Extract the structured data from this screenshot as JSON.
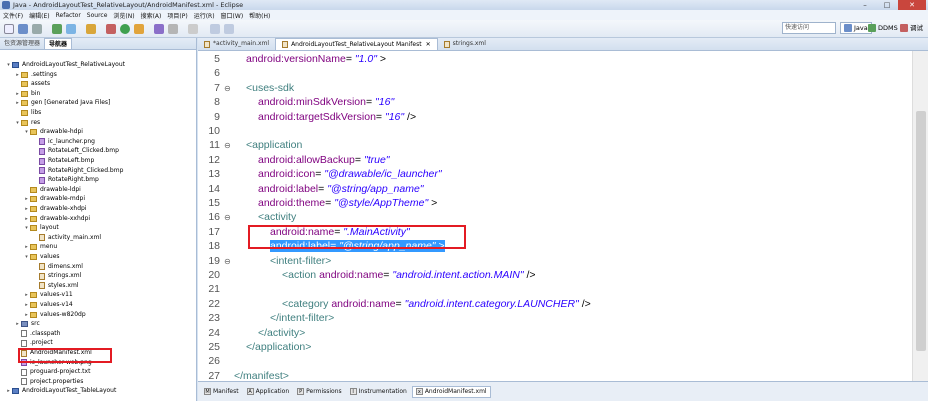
{
  "window": {
    "title": "Java - AndroidLayoutTest_RelativeLayout/AndroidManifest.xml - Eclipse",
    "minimize": "–",
    "maximize": "□",
    "close": "✕"
  },
  "menu": [
    "文件(F)",
    "编辑(E)",
    "Refactor",
    "Source",
    "浏览(N)",
    "搜索(A)",
    "项目(P)",
    "运行(R)",
    "窗口(W)",
    "帮助(H)"
  ],
  "toolbar": {
    "quick_access": "快速访问",
    "perspectives": [
      "Java",
      "DDMS",
      "调试"
    ]
  },
  "left_panel": {
    "tabs": [
      "包资源管理器",
      "导航器"
    ],
    "tree": [
      {
        "label": "AndroidLayoutTest_RelativeLayout",
        "depth": 0,
        "icon": "project-icon",
        "tw": "▾"
      },
      {
        "label": ".settings",
        "depth": 1,
        "icon": "folder-icon",
        "tw": "▸"
      },
      {
        "label": "assets",
        "depth": 1,
        "icon": "folder-icon",
        "tw": ""
      },
      {
        "label": "bin",
        "depth": 1,
        "icon": "folder-icon",
        "tw": "▸"
      },
      {
        "label": "gen [Generated Java Files]",
        "depth": 1,
        "icon": "folder-icon",
        "tw": "▸"
      },
      {
        "label": "libs",
        "depth": 1,
        "icon": "folder-icon",
        "tw": ""
      },
      {
        "label": "res",
        "depth": 1,
        "icon": "folder-icon",
        "tw": "▾"
      },
      {
        "label": "drawable-hdpi",
        "depth": 2,
        "icon": "folder-icon",
        "tw": "▾"
      },
      {
        "label": "ic_launcher.png",
        "depth": 3,
        "icon": "image-file-icon",
        "tw": ""
      },
      {
        "label": "RotateLeft_Clicked.bmp",
        "depth": 3,
        "icon": "image-file-icon",
        "tw": ""
      },
      {
        "label": "RotateLeft.bmp",
        "depth": 3,
        "icon": "image-file-icon",
        "tw": ""
      },
      {
        "label": "RotateRight_Clicked.bmp",
        "depth": 3,
        "icon": "image-file-icon",
        "tw": ""
      },
      {
        "label": "RotateRight.bmp",
        "depth": 3,
        "icon": "image-file-icon",
        "tw": ""
      },
      {
        "label": "drawable-ldpi",
        "depth": 2,
        "icon": "folder-icon",
        "tw": ""
      },
      {
        "label": "drawable-mdpi",
        "depth": 2,
        "icon": "folder-icon",
        "tw": "▸"
      },
      {
        "label": "drawable-xhdpi",
        "depth": 2,
        "icon": "folder-icon",
        "tw": "▸"
      },
      {
        "label": "drawable-xxhdpi",
        "depth": 2,
        "icon": "folder-icon",
        "tw": "▸"
      },
      {
        "label": "layout",
        "depth": 2,
        "icon": "folder-icon",
        "tw": "▾"
      },
      {
        "label": "activity_main.xml",
        "depth": 3,
        "icon": "xml-file-icon",
        "tw": ""
      },
      {
        "label": "menu",
        "depth": 2,
        "icon": "folder-icon",
        "tw": "▸"
      },
      {
        "label": "values",
        "depth": 2,
        "icon": "folder-icon",
        "tw": "▾"
      },
      {
        "label": "dimens.xml",
        "depth": 3,
        "icon": "xml-file-icon",
        "tw": ""
      },
      {
        "label": "strings.xml",
        "depth": 3,
        "icon": "xml-file-icon",
        "tw": ""
      },
      {
        "label": "styles.xml",
        "depth": 3,
        "icon": "xml-file-icon",
        "tw": ""
      },
      {
        "label": "values-v11",
        "depth": 2,
        "icon": "folder-icon",
        "tw": "▸"
      },
      {
        "label": "values-v14",
        "depth": 2,
        "icon": "folder-icon",
        "tw": "▸"
      },
      {
        "label": "values-w820dp",
        "depth": 2,
        "icon": "folder-icon",
        "tw": "▸"
      },
      {
        "label": "src",
        "depth": 1,
        "icon": "package-folder-icon",
        "tw": "▸"
      },
      {
        "label": ".classpath",
        "depth": 1,
        "icon": "file-icon",
        "tw": ""
      },
      {
        "label": ".project",
        "depth": 1,
        "icon": "file-icon",
        "tw": ""
      },
      {
        "label": "AndroidManifest.xml",
        "depth": 1,
        "icon": "xml-file-icon",
        "tw": ""
      },
      {
        "label": "ic_launcher-web.png",
        "depth": 1,
        "icon": "image-file-icon",
        "tw": ""
      },
      {
        "label": "proguard-project.txt",
        "depth": 1,
        "icon": "file-icon",
        "tw": ""
      },
      {
        "label": "project.properties",
        "depth": 1,
        "icon": "file-icon",
        "tw": ""
      },
      {
        "label": "AndroidLayoutTest_TableLayout",
        "depth": 0,
        "icon": "project-icon",
        "tw": "▸"
      }
    ]
  },
  "editor": {
    "tabs": [
      "*activity_main.xml",
      "AndroidLayoutTest_RelativeLayout Manifest",
      "strings.xml"
    ],
    "close_x": "✕",
    "lines": [
      {
        "n": "5",
        "indent": 1,
        "parts": [
          [
            "a",
            "android:versionName"
          ],
          [
            "p",
            "= "
          ],
          [
            "v",
            "\"1.0\""
          ],
          [
            "p",
            " >"
          ]
        ]
      },
      {
        "n": "6",
        "indent": 0,
        "parts": []
      },
      {
        "n": "7",
        "indent": 1,
        "parts": [
          [
            "t",
            "<uses-sdk"
          ]
        ]
      },
      {
        "n": "8",
        "indent": 2,
        "parts": [
          [
            "a",
            "android:minSdkVersion"
          ],
          [
            "p",
            "= "
          ],
          [
            "v",
            "\"16\""
          ]
        ]
      },
      {
        "n": "9",
        "indent": 2,
        "parts": [
          [
            "a",
            "android:targetSdkVersion"
          ],
          [
            "p",
            "= "
          ],
          [
            "v",
            "\"16\""
          ],
          [
            "p",
            " />"
          ]
        ]
      },
      {
        "n": "10",
        "indent": 0,
        "parts": []
      },
      {
        "n": "11",
        "indent": 1,
        "parts": [
          [
            "t",
            "<application"
          ]
        ]
      },
      {
        "n": "12",
        "indent": 2,
        "parts": [
          [
            "a",
            "android:allowBackup"
          ],
          [
            "p",
            "= "
          ],
          [
            "v",
            "\"true\""
          ]
        ]
      },
      {
        "n": "13",
        "indent": 2,
        "parts": [
          [
            "a",
            "android:icon"
          ],
          [
            "p",
            "= "
          ],
          [
            "v",
            "\"@drawable/ic_launcher\""
          ]
        ]
      },
      {
        "n": "14",
        "indent": 2,
        "parts": [
          [
            "a",
            "android:label"
          ],
          [
            "p",
            "= "
          ],
          [
            "v",
            "\"@string/app_name\""
          ]
        ]
      },
      {
        "n": "15",
        "indent": 2,
        "parts": [
          [
            "a",
            "android:theme"
          ],
          [
            "p",
            "= "
          ],
          [
            "v",
            "\"@style/AppTheme\""
          ],
          [
            "p",
            " >"
          ]
        ]
      },
      {
        "n": "16",
        "indent": 2,
        "parts": [
          [
            "t",
            "<activity"
          ]
        ]
      },
      {
        "n": "17",
        "indent": 3,
        "parts": [
          [
            "a",
            "android:name"
          ],
          [
            "p",
            "= "
          ],
          [
            "v",
            "\".MainActivity\""
          ]
        ]
      },
      {
        "n": "18",
        "indent": 3,
        "parts": [
          [
            "a",
            "android:label"
          ],
          [
            "p",
            "= "
          ],
          [
            "v",
            "\"@string/app_name\""
          ],
          [
            "p",
            " >"
          ]
        ],
        "selected": true
      },
      {
        "n": "19",
        "indent": 3,
        "parts": [
          [
            "t",
            "<intent-filter>"
          ]
        ]
      },
      {
        "n": "20",
        "indent": 4,
        "parts": [
          [
            "t",
            "<action "
          ],
          [
            "a",
            "android:name"
          ],
          [
            "p",
            "= "
          ],
          [
            "v",
            "\"android.intent.action.MAIN\""
          ],
          [
            "p",
            " />"
          ]
        ]
      },
      {
        "n": "21",
        "indent": 0,
        "parts": []
      },
      {
        "n": "22",
        "indent": 4,
        "parts": [
          [
            "t",
            "<category "
          ],
          [
            "a",
            "android:name"
          ],
          [
            "p",
            "= "
          ],
          [
            "v",
            "\"android.intent.category.LAUNCHER\""
          ],
          [
            "p",
            " />"
          ]
        ]
      },
      {
        "n": "23",
        "indent": 3,
        "parts": [
          [
            "t",
            "</intent-filter>"
          ]
        ]
      },
      {
        "n": "24",
        "indent": 2,
        "parts": [
          [
            "t",
            "</activity>"
          ]
        ]
      },
      {
        "n": "25",
        "indent": 1,
        "parts": [
          [
            "t",
            "</application>"
          ]
        ]
      },
      {
        "n": "26",
        "indent": 0,
        "parts": []
      },
      {
        "n": "27",
        "indent": 0,
        "parts": [
          [
            "t",
            "</manifest>"
          ]
        ]
      },
      {
        "n": "28",
        "indent": 0,
        "parts": []
      }
    ],
    "bottom_tabs": [
      {
        "label": "Manifest",
        "icon": "M"
      },
      {
        "label": "Application",
        "icon": "A"
      },
      {
        "label": "Permissions",
        "icon": "P"
      },
      {
        "label": "Instrumentation",
        "icon": "I"
      },
      {
        "label": "AndroidManifest.xml",
        "icon": "x"
      }
    ]
  },
  "colors": {
    "tag": "#3f7f7f",
    "attr": "#7f007f",
    "value": "#2a00ff",
    "highlight": "#e31b23",
    "selection": "#3399ff"
  }
}
